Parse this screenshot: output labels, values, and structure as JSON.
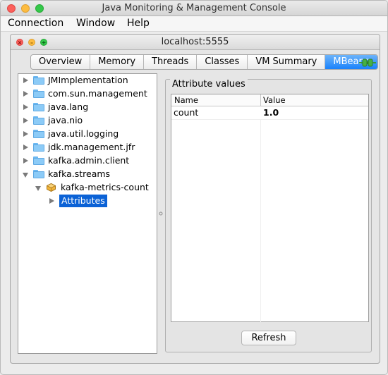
{
  "window": {
    "title": "Java Monitoring & Management Console"
  },
  "menubar": {
    "items": [
      "Connection",
      "Window",
      "Help"
    ]
  },
  "internal_frame": {
    "title": "localhost:5555"
  },
  "tabs": [
    {
      "label": "Overview",
      "active": false
    },
    {
      "label": "Memory",
      "active": false
    },
    {
      "label": "Threads",
      "active": false
    },
    {
      "label": "Classes",
      "active": false
    },
    {
      "label": "VM Summary",
      "active": false
    },
    {
      "label": "MBeans",
      "active": true
    }
  ],
  "tree": {
    "nodes": [
      {
        "label": "JMImplementation",
        "type": "folder",
        "expanded": false
      },
      {
        "label": "com.sun.management",
        "type": "folder",
        "expanded": false
      },
      {
        "label": "java.lang",
        "type": "folder",
        "expanded": false
      },
      {
        "label": "java.nio",
        "type": "folder",
        "expanded": false
      },
      {
        "label": "java.util.logging",
        "type": "folder",
        "expanded": false
      },
      {
        "label": "jdk.management.jfr",
        "type": "folder",
        "expanded": false
      },
      {
        "label": "kafka.admin.client",
        "type": "folder",
        "expanded": false
      },
      {
        "label": "kafka.streams",
        "type": "folder",
        "expanded": true
      },
      {
        "label": "kafka-metrics-count",
        "type": "bean",
        "expanded": true
      },
      {
        "label": "Attributes",
        "type": "leaf",
        "expanded": false,
        "selected": true
      }
    ]
  },
  "attributes": {
    "group_title": "Attribute values",
    "columns": [
      "Name",
      "Value"
    ],
    "rows": [
      {
        "name": "count",
        "value": "1.0"
      }
    ],
    "refresh_label": "Refresh"
  },
  "colors": {
    "accent": "#1a82fb",
    "selection": "#0b62d6"
  }
}
